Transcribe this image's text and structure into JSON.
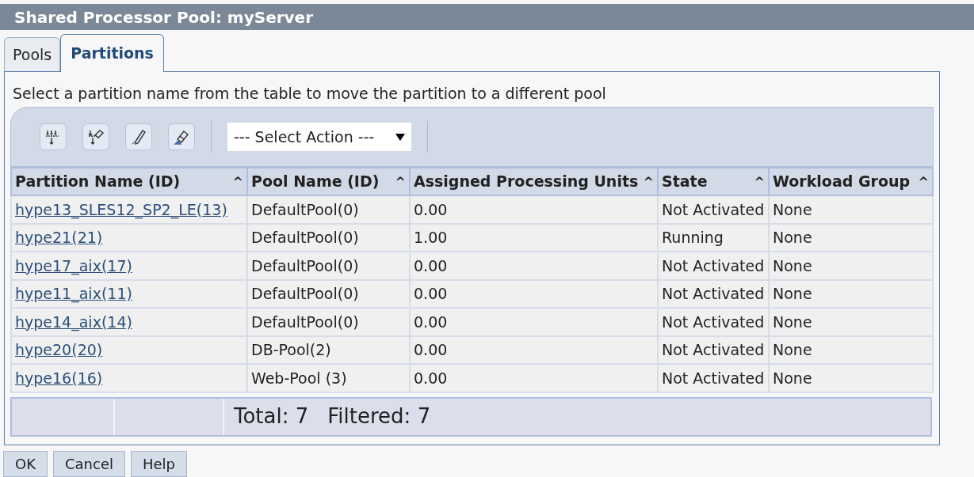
{
  "window": {
    "title": "Shared Processor Pool: myServer"
  },
  "tabs": [
    {
      "label": "Pools",
      "selected": false
    },
    {
      "label": "Partitions",
      "selected": true
    }
  ],
  "instruction": "Select a partition name from the table to move the partition to a different pool",
  "toolbar": {
    "action_select": {
      "value": "--- Select Action ---"
    }
  },
  "table": {
    "columns": [
      {
        "label": "Partition Name (ID)",
        "sort_mark": "^"
      },
      {
        "label": "Pool Name (ID)",
        "sort_mark": "^"
      },
      {
        "label": "Assigned Processing Units",
        "sort_mark": "^"
      },
      {
        "label": "State",
        "sort_mark": "^"
      },
      {
        "label": "Workload Group",
        "sort_mark": "^"
      }
    ],
    "rows": [
      [
        "hype13_SLES12_SP2_LE(13)",
        "DefaultPool(0)",
        "0.00",
        "Not Activated",
        "None"
      ],
      [
        "hype21(21)",
        "DefaultPool(0)",
        "1.00",
        "Running",
        "None"
      ],
      [
        "hype17_aix(17)",
        "DefaultPool(0)",
        "0.00",
        "Not Activated",
        "None"
      ],
      [
        "hype11_aix(11)",
        "DefaultPool(0)",
        "0.00",
        "Not Activated",
        "None"
      ],
      [
        "hype14_aix(14)",
        "DefaultPool(0)",
        "0.00",
        "Not Activated",
        "None"
      ],
      [
        "hype20(20)",
        "DB-Pool(2)",
        "0.00",
        "Not Activated",
        "None"
      ],
      [
        "hype16(16)",
        "Web-Pool (3)",
        "0.00",
        "Not Activated",
        "None"
      ]
    ],
    "footer": {
      "total": "Total: 7",
      "filtered": "Filtered: 7"
    }
  },
  "buttons": [
    "OK",
    "Cancel",
    "Help"
  ]
}
